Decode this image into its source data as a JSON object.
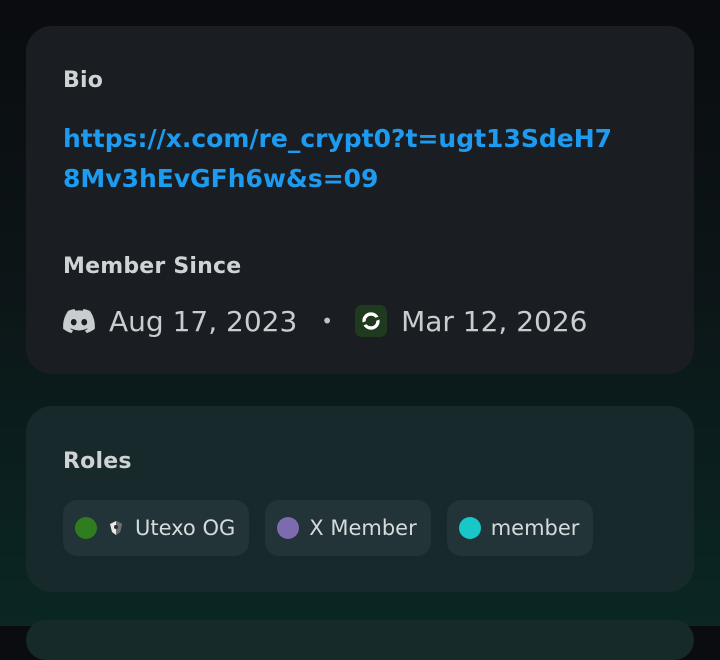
{
  "bio": {
    "heading": "Bio",
    "link_text": "https://x.com/re_crypt0?t=ugt13SdeH78Mv3hEvGFh6w&s=09",
    "href": "https://x.com/re_crypt0?t=ugt13SdeH78Mv3hEvGFh6w&s=09"
  },
  "member_since": {
    "heading": "Member Since",
    "discord_icon": "discord-icon",
    "discord_date": "Aug 17, 2023",
    "separator": "•",
    "app_icon": "app-logo-icon",
    "app_date": "Mar 12, 2026"
  },
  "roles": {
    "heading": "Roles",
    "items": [
      {
        "label": "Utexo OG",
        "color": "#2f7d1f",
        "icon": "badge-icon"
      },
      {
        "label": "X Member",
        "color": "#7d6bb0",
        "icon": null
      },
      {
        "label": "member",
        "color": "#19c7c9",
        "icon": null
      }
    ]
  }
}
